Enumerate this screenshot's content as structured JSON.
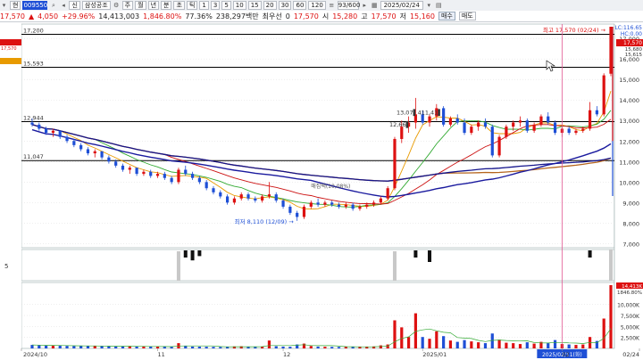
{
  "toolbar": {
    "mode_label": "현",
    "code": "009550",
    "stock_name": "삼성공조",
    "period_buttons": [
      "주",
      "월",
      "년",
      "분",
      "초",
      "틱"
    ],
    "minute_buttons": [
      "1",
      "3",
      "5",
      "10",
      "15",
      "20",
      "30",
      "60",
      "120"
    ],
    "count": "93/600",
    "date": "2025/02/24"
  },
  "quote": {
    "price": "17,570",
    "change": "4,050",
    "change_pct": "+29.96%",
    "volume": "14,413,003",
    "vol_ratio": "1,846.80%",
    "turnover": "77.36%",
    "amount": "238,297백만",
    "min_order_label": "최우선",
    "min_order": "0",
    "last": "17,570",
    "open_label": "시",
    "open": "15,280",
    "high_label": "고",
    "high": "17,570",
    "low_label": "저",
    "low": "15,160",
    "buy_label": "매수",
    "sell_label": "매도"
  },
  "chart": {
    "lc_label": "LC:116.65",
    "hc_label": "HC:0.00",
    "price_badges": [
      "17,570",
      "15,680",
      "15,615"
    ],
    "hlines": [
      {
        "label": "17,200",
        "value": 17200
      },
      {
        "label": "15,593",
        "value": 15593
      },
      {
        "label": "12,944",
        "value": 12944
      },
      {
        "label": "11,047",
        "value": 11047
      }
    ],
    "high_annotation": "최고 17,570 (02/24) →",
    "low_annotation": "최저 8,110 (12/09) →",
    "sub_annotation": "13,07▌411,41▌",
    "sub_annotation2": "12,66▌",
    "mid_annotation": "매집택(10,08%)",
    "y_ticks": [
      "17,000",
      "16,000",
      "15,000",
      "14,000",
      "13,000",
      "12,000",
      "11,000",
      "10,000",
      "9,000",
      "8,000",
      "7,000"
    ],
    "indicator_label": "5",
    "volume_badges": [
      "14,413K",
      "1846.80%"
    ],
    "volume_ticks": [
      "10,000K",
      "7,500K",
      "5,000K",
      "2,500K"
    ],
    "x_labels": [
      "2024/10",
      "11",
      "12",
      "2025/01",
      "02",
      "02/24"
    ],
    "cursor_date": "2025/02/11(화)"
  },
  "chart_data": {
    "type": "candlestick",
    "ylim": [
      6800,
      17700
    ],
    "candles": [
      [
        12900,
        13100,
        12700,
        12800
      ],
      [
        12800,
        12900,
        12500,
        12600
      ],
      [
        12600,
        12700,
        12300,
        12400
      ],
      [
        12400,
        12600,
        12200,
        12500
      ],
      [
        12500,
        12500,
        12100,
        12200
      ],
      [
        12200,
        12300,
        11900,
        12000
      ],
      [
        12000,
        12100,
        11700,
        11800
      ],
      [
        11800,
        11900,
        11500,
        11600
      ],
      [
        11600,
        11700,
        11300,
        11400
      ],
      [
        11400,
        11600,
        11200,
        11500
      ],
      [
        11500,
        11500,
        11100,
        11200
      ],
      [
        11200,
        11300,
        10900,
        11000
      ],
      [
        11000,
        11100,
        10700,
        10800
      ],
      [
        10800,
        10900,
        10500,
        10600
      ],
      [
        10600,
        10800,
        10400,
        10700
      ],
      [
        10700,
        10700,
        10300,
        10400
      ],
      [
        10400,
        10600,
        10300,
        10500
      ],
      [
        10500,
        10600,
        10200,
        10300
      ],
      [
        10300,
        10500,
        10200,
        10400
      ],
      [
        10400,
        10500,
        10100,
        10200
      ],
      [
        10200,
        10300,
        9900,
        10000
      ],
      [
        10000,
        10700,
        9900,
        10600
      ],
      [
        10600,
        10800,
        10300,
        10400
      ],
      [
        10400,
        10500,
        10100,
        10200
      ],
      [
        10200,
        10300,
        9900,
        10000
      ],
      [
        10000,
        10100,
        9600,
        9700
      ],
      [
        9700,
        9800,
        9400,
        9500
      ],
      [
        9500,
        9600,
        9200,
        9300
      ],
      [
        9300,
        9400,
        8900,
        9000
      ],
      [
        9000,
        9300,
        8900,
        9200
      ],
      [
        9200,
        9500,
        9100,
        9400
      ],
      [
        9400,
        9500,
        9100,
        9200
      ],
      [
        9200,
        9300,
        9000,
        9100
      ],
      [
        9100,
        9400,
        9000,
        9300
      ],
      [
        9300,
        10000,
        9200,
        9400
      ],
      [
        9400,
        9500,
        9000,
        9100
      ],
      [
        9100,
        9200,
        8700,
        8800
      ],
      [
        8800,
        8900,
        8400,
        8500
      ],
      [
        8500,
        8600,
        8110,
        8300
      ],
      [
        8300,
        8900,
        8200,
        8800
      ],
      [
        8800,
        9100,
        8700,
        9000
      ],
      [
        9000,
        9200,
        8800,
        8900
      ],
      [
        8900,
        9100,
        8800,
        9000
      ],
      [
        9000,
        9100,
        8800,
        8900
      ],
      [
        8900,
        9000,
        8700,
        8800
      ],
      [
        8800,
        9000,
        8700,
        8900
      ],
      [
        8900,
        9000,
        8600,
        8700
      ],
      [
        8700,
        8900,
        8600,
        8800
      ],
      [
        8800,
        9000,
        8700,
        8900
      ],
      [
        8900,
        9100,
        8800,
        9000
      ],
      [
        9000,
        9300,
        8900,
        9200
      ],
      [
        9200,
        9800,
        9100,
        9700
      ],
      [
        9700,
        12200,
        9600,
        12100
      ],
      [
        12100,
        13000,
        11900,
        12700
      ],
      [
        12700,
        13200,
        12400,
        12900
      ],
      [
        12900,
        14100,
        12600,
        13300
      ],
      [
        13300,
        13500,
        12800,
        12900
      ],
      [
        12900,
        13300,
        12700,
        13200
      ],
      [
        13200,
        13800,
        13000,
        13600
      ],
      [
        13600,
        13700,
        12700,
        12800
      ],
      [
        12800,
        13200,
        12700,
        13100
      ],
      [
        13100,
        13300,
        12800,
        12900
      ],
      [
        12900,
        13100,
        12300,
        12400
      ],
      [
        12400,
        12800,
        12300,
        12700
      ],
      [
        12700,
        13000,
        12500,
        12900
      ],
      [
        12900,
        13100,
        12600,
        12700
      ],
      [
        12700,
        12800,
        11200,
        11300
      ],
      [
        11300,
        12300,
        11200,
        12200
      ],
      [
        12200,
        12800,
        12100,
        12700
      ],
      [
        12700,
        13000,
        12500,
        12900
      ],
      [
        12900,
        13200,
        12700,
        13000
      ],
      [
        13000,
        13100,
        12400,
        12500
      ],
      [
        12500,
        12900,
        12400,
        12800
      ],
      [
        12800,
        13300,
        12700,
        13200
      ],
      [
        13200,
        13400,
        12800,
        12900
      ],
      [
        12900,
        13000,
        12300,
        12400
      ],
      [
        12400,
        12700,
        12200,
        12600
      ],
      [
        12600,
        12700,
        12300,
        12400
      ],
      [
        12400,
        12600,
        12300,
        12500
      ],
      [
        12500,
        12700,
        12400,
        12600
      ],
      [
        12600,
        13900,
        12500,
        13500
      ],
      [
        13500,
        13700,
        13200,
        13300
      ],
      [
        13300,
        15300,
        13200,
        15200
      ],
      [
        15280,
        17570,
        15160,
        17570
      ]
    ],
    "volume": [
      800,
      700,
      650,
      600,
      620,
      580,
      560,
      540,
      520,
      600,
      500,
      480,
      460,
      450,
      500,
      440,
      430,
      420,
      410,
      400,
      390,
      1200,
      600,
      420,
      400,
      380,
      360,
      340,
      330,
      450,
      500,
      380,
      340,
      420,
      1800,
      500,
      420,
      380,
      900,
      1100,
      560,
      420,
      380,
      360,
      340,
      420,
      360,
      340,
      400,
      450,
      700,
      900,
      6400,
      4800,
      2600,
      8000,
      2600,
      2200,
      3900,
      2800,
      1800,
      1500,
      1900,
      1600,
      1400,
      1200,
      3400,
      2000,
      1300,
      1200,
      1000,
      1400,
      1100,
      1500,
      1200,
      1900,
      1000,
      900,
      800,
      900,
      2600,
      1700,
      6800,
      14413
    ]
  }
}
